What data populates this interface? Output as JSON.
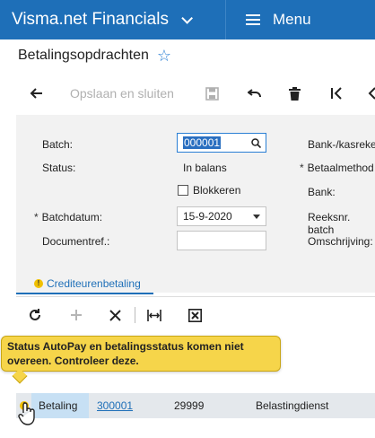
{
  "header": {
    "app_name": "Visma.net Financials",
    "app_chevron_icon": "chevron-down-icon",
    "menu_label": "Menu",
    "menu_icon": "hamburger-icon",
    "bar_color": "#1e6fb8"
  },
  "page": {
    "title": "Betalingsopdrachten",
    "favorite_icon": "star-outline-icon"
  },
  "toolbar": {
    "save_close_label": "Opslaan en sluiten"
  },
  "form": {
    "batch_label": "Batch:",
    "batch_value": "000001",
    "status_label": "Status:",
    "status_value": "In balans",
    "block_label": "Blokkeren",
    "batchdate_label": "Batchdatum:",
    "batchdate_value": "15-9-2020",
    "docref_label": "Documentref.:",
    "docref_value": "",
    "bank_account_label": "Bank-/kasreke",
    "payment_method_label": "Betaalmethod",
    "bank_label": "Bank:",
    "series_label": "Reeksnr. batch",
    "description_label": "Omschrijving:"
  },
  "tabs": [
    {
      "label": "Crediteurenbetaling"
    }
  ],
  "tooltip": {
    "text": "Status AutoPay en betalingsstatus komen niet overeen. Controleer deze."
  },
  "grid": {
    "rows": [
      {
        "type": "Betaling",
        "ref": "300001",
        "supplier": "29999",
        "name": "Belastingdienst"
      }
    ]
  },
  "colors": {
    "accent": "#1e6fb8",
    "warning": "#f6d54a",
    "panel": "#f2f2f2",
    "row": "#e4e8ec"
  }
}
